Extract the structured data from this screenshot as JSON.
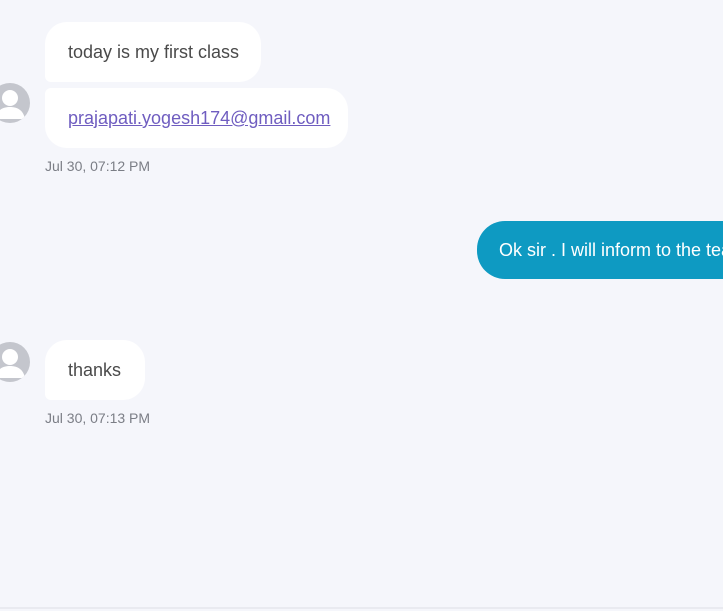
{
  "conversation": {
    "group1": {
      "messages": [
        {
          "text": "today is my first class"
        },
        {
          "text": "prajapati.yogesh174@gmail.com"
        }
      ],
      "timestamp": "Jul 30, 07:12 PM"
    },
    "outgoing": {
      "text": "Ok sir . I will inform to the tea"
    },
    "group2": {
      "messages": [
        {
          "text": "thanks"
        }
      ],
      "timestamp": "Jul 30, 07:13 PM"
    }
  },
  "colors": {
    "background": "#f5f6fb",
    "incoming_bubble": "#ffffff",
    "outgoing_bubble": "#0e9ac2",
    "link": "#6f5dc0",
    "avatar": "#c4c6cd",
    "timestamp": "#7b7e86"
  },
  "icons": {
    "avatar": "user-silhouette-icon"
  }
}
